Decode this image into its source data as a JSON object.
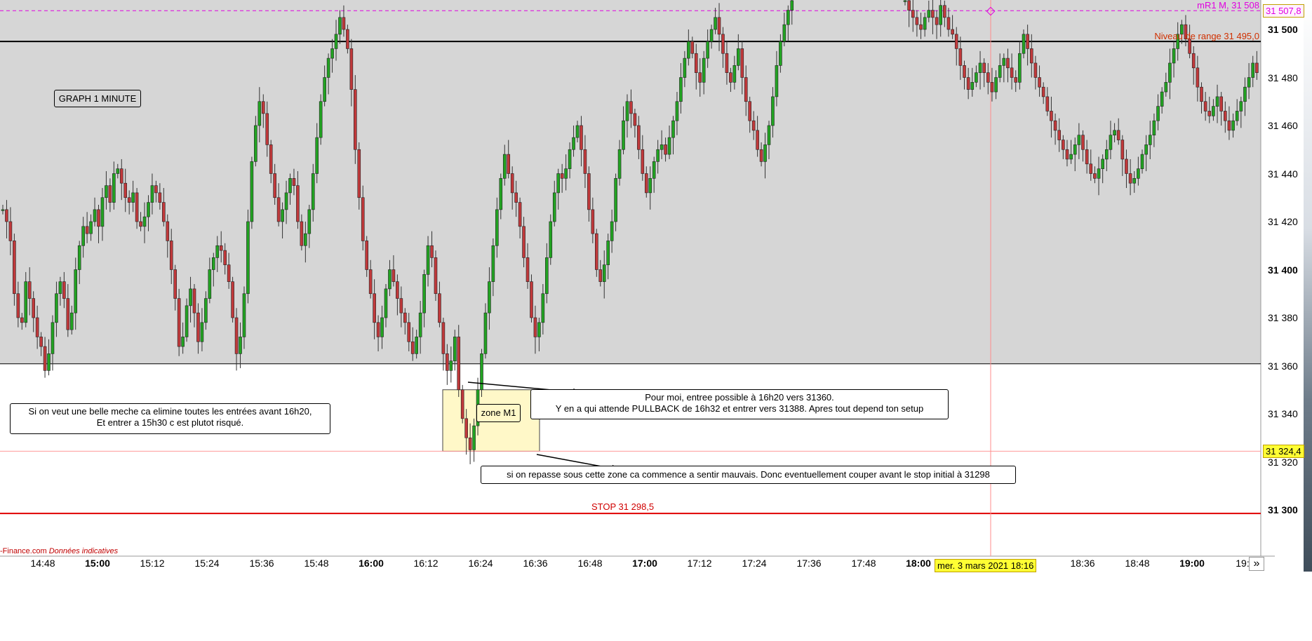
{
  "chart_data": {
    "type": "candlestick",
    "timeframe_label": "GRAPH 1 MINUTE",
    "y_ticks": [
      "31 500",
      "31 480",
      "31 460",
      "31 440",
      "31 420",
      "31 400",
      "31 380",
      "31 360",
      "31 340",
      "31 320",
      "31 300"
    ],
    "y_ticks_bold": [
      "31 500",
      "31 400",
      "31 300"
    ],
    "y_range": [
      31278,
      31512
    ],
    "x_ticks": [
      "14:48",
      "15:00",
      "15:12",
      "15:24",
      "15:36",
      "15:48",
      "16:00",
      "16:12",
      "16:24",
      "16:36",
      "16:48",
      "17:00",
      "17:12",
      "17:24",
      "17:36",
      "17:48",
      "18:00",
      "18:36",
      "18:48",
      "19:00",
      "19:"
    ],
    "x_ticks_bold": [
      "15:00",
      "16:00",
      "17:00",
      "18:00",
      "19:00"
    ],
    "levels": [
      {
        "name": "mR1 M",
        "label": "mR1 M, 31 508",
        "value": 31507.8,
        "price_badge": "31 507,8",
        "style": "dashed",
        "color": "#e000e0"
      },
      {
        "name": "Niveau de range",
        "label": "Niveau de range 31 495,0",
        "value": 31495.0,
        "style": "solid",
        "color": "#000000"
      },
      {
        "name": "range low",
        "value": 31360.8,
        "style": "solid",
        "color": "#000000"
      },
      {
        "name": "zone low",
        "value": 31324.4,
        "price_badge": "31 324,4",
        "style": "thin",
        "color": "#ff8888"
      },
      {
        "name": "STOP",
        "label": "STOP 31 298,5",
        "value": 31298.5,
        "style": "solid",
        "color": "#e00000"
      }
    ],
    "range_band": {
      "low": 31360.8,
      "high": 31512,
      "color": "#d6d6d6"
    },
    "zone": {
      "label": "zone M1",
      "low": 31324.4,
      "high": 31350,
      "color": "#fff8c8"
    },
    "crosshair": {
      "time_label": "mer. 3 mars 2021 18:16"
    },
    "candles_close": [
      31425,
      31420,
      31412,
      31390,
      31380,
      31378,
      31395,
      31388,
      31380,
      31372,
      31368,
      31358,
      31365,
      31378,
      31390,
      31395,
      31388,
      31375,
      31382,
      31400,
      31410,
      31418,
      31415,
      31420,
      31425,
      31418,
      31430,
      31435,
      31428,
      31440,
      31442,
      31436,
      31430,
      31428,
      31432,
      31420,
      31418,
      31422,
      31428,
      31435,
      31432,
      31428,
      31420,
      31412,
      31400,
      31388,
      31368,
      31372,
      31385,
      31392,
      31382,
      31370,
      31378,
      31388,
      31400,
      31405,
      31410,
      31408,
      31402,
      31395,
      31380,
      31365,
      31372,
      31390,
      31420,
      31445,
      31460,
      31470,
      31465,
      31452,
      31440,
      31430,
      31420,
      31425,
      31432,
      31438,
      31435,
      31420,
      31410,
      31415,
      31425,
      31440,
      31455,
      31470,
      31480,
      31488,
      31492,
      31498,
      31505,
      31500,
      31492,
      31475,
      31450,
      31430,
      31412,
      31400,
      31390,
      31378,
      31372,
      31380,
      31392,
      31400,
      31395,
      31388,
      31382,
      31378,
      31370,
      31365,
      31372,
      31382,
      31398,
      31410,
      31405,
      31390,
      31378,
      31365,
      31358,
      31362,
      31372,
      31350,
      31338,
      31330,
      31325,
      31335,
      31350,
      31365,
      31382,
      31395,
      31410,
      31425,
      31438,
      31448,
      31440,
      31432,
      31428,
      31418,
      31405,
      31395,
      31380,
      31372,
      31378,
      31390,
      31405,
      31420,
      31432,
      31440,
      31438,
      31442,
      31450,
      31455,
      31460,
      31450,
      31440,
      31425,
      31415,
      31400,
      31395,
      31402,
      31412,
      31420,
      31438,
      31450,
      31462,
      31470,
      31465,
      31460,
      31450,
      31440,
      31432,
      31438,
      31445,
      31450,
      31452,
      31448,
      31455,
      31462,
      31470,
      31480,
      31488,
      31495,
      31490,
      31482,
      31478,
      31488,
      31495,
      31500,
      31505,
      31498,
      31490,
      31482,
      31478,
      31485,
      31492,
      31480,
      31470,
      31462,
      31458,
      31450,
      31445,
      31452,
      31460,
      31472,
      31485,
      31495,
      31502,
      31508,
      31512
    ],
    "candles_close_late": [
      31512,
      31508,
      31505,
      31502,
      31500,
      31505,
      31508,
      31505,
      31502,
      31510,
      31505,
      31500,
      31498,
      31492,
      31485,
      31480,
      31475,
      31478,
      31482,
      31486,
      31482,
      31478,
      31474,
      31480,
      31485,
      31488,
      31484,
      31480,
      31478,
      31490,
      31498,
      31492,
      31486,
      31480,
      31476,
      31472,
      31466,
      31462,
      31458,
      31454,
      31450,
      31446,
      31448,
      31452,
      31456,
      31450,
      31444,
      31440,
      31438,
      31442,
      31446,
      31450,
      31456,
      31458,
      31454,
      31446,
      31440,
      31436,
      31438,
      31442,
      31448,
      31452,
      31456,
      31462,
      31468,
      31474,
      31478,
      31486,
      31492,
      31498,
      31502,
      31496,
      31490,
      31484,
      31476,
      31470,
      31466,
      31464,
      31468,
      31472,
      31466,
      31462,
      31458,
      31462,
      31466,
      31470,
      31476,
      31480,
      31486,
      31482
    ]
  },
  "notes": {
    "left": [
      "Si on veut une belle meche ca elimine toutes les entrées  avant 16h20,",
      "Et entrer a 15h30 c est plutot risqué."
    ],
    "entry": [
      "Pour moi, entree possible à 16h20 vers 31360.",
      "Y en a qui attende PULLBACK de 16h32 et entrer  vers  31388. Apres tout depend ton setup"
    ],
    "zone_exit": "si on repasse sous cette zone ca commence a sentir mauvais. Donc eventuellement couper avant le stop initial à 31298"
  },
  "source": {
    "name": "-Finance.com",
    "note": "Données indicatives"
  },
  "scroll_glyph": "»",
  "colors": {
    "up": "#22a322",
    "down": "#c0393b",
    "band": "#d6d6d6",
    "badge_yellow": "#ffff33"
  }
}
